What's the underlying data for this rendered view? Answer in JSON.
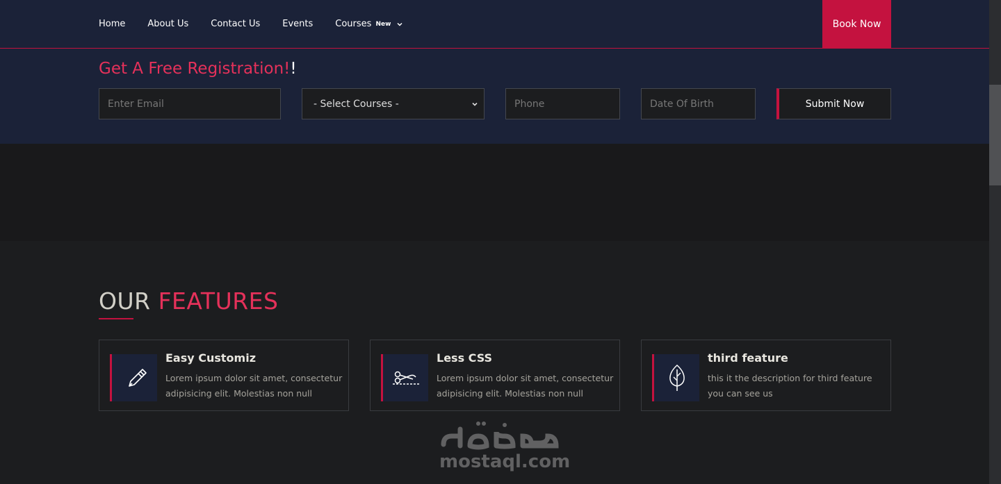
{
  "nav": {
    "items": [
      {
        "label": "Home"
      },
      {
        "label": "About Us"
      },
      {
        "label": "Contact Us"
      },
      {
        "label": "Events"
      },
      {
        "label": "Courses",
        "badge": "New"
      }
    ],
    "book_label": "Book Now"
  },
  "registration": {
    "title": "Get A Free Registration!",
    "title_excl": "!",
    "email_placeholder": "Enter Email",
    "course_selected": "- Select Courses -",
    "phone_placeholder": "Phone",
    "dob_placeholder": "Date Of Birth",
    "submit_label": "Submit Now"
  },
  "features": {
    "heading_main": "OUR",
    "heading_accent": "FEATURES",
    "cards": [
      {
        "title": "Easy Customiz",
        "desc": "Lorem ipsum dolor sit amet, consectetur adipisicing elit. Molestias non null",
        "icon": "pen-icon"
      },
      {
        "title": "Less CSS",
        "desc": "Lorem ipsum dolor sit amet, consectetur adipisicing elit. Molestias non null",
        "icon": "scissors-cut-icon"
      },
      {
        "title": "third feature",
        "desc": "this it the description for third feature you can see us",
        "icon": "leaf-icon"
      }
    ]
  },
  "watermark": {
    "text": "mostaql.com",
    "logo": "مستقل"
  },
  "colors": {
    "navy": "#1b2238",
    "accent": "#c4123f",
    "accent_text": "#e5315a",
    "dark_bg": "#1c1d1f"
  }
}
